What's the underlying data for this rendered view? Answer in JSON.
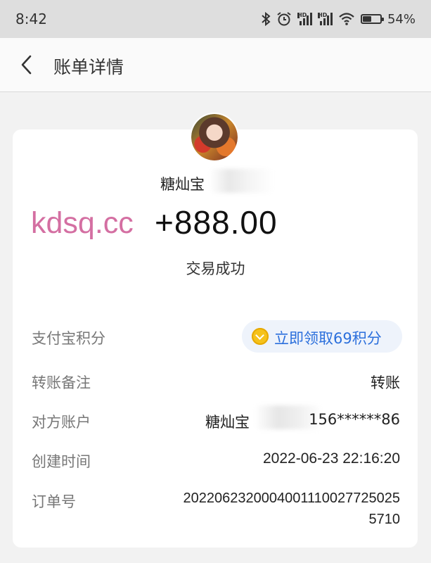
{
  "status_bar": {
    "time": "8:42",
    "battery": "54%",
    "battery_level": 0.54,
    "icons": [
      "bluetooth-icon",
      "alarm-icon",
      "hd-signal-icon",
      "hd-signal-icon",
      "wifi-icon",
      "battery-icon"
    ]
  },
  "header": {
    "title": "账单详情",
    "back_icon": "chevron-left-icon"
  },
  "transaction": {
    "payee": "糖灿宝",
    "watermark": "kdsq.cc",
    "amount": "+888.00",
    "status": "交易成功"
  },
  "details": {
    "points_label": "支付宝积分",
    "points_action": "立即领取69积分",
    "remark_label": "转账备注",
    "remark_value": "转账",
    "account_label": "对方账户",
    "account_prefix": "糖灿宝",
    "account_suffix": "156******86",
    "created_label": "创建时间",
    "created_value": "2022-06-23 22:16:20",
    "order_label": "订单号",
    "order_line1": "2022062320004001110027725025",
    "order_line2": "5710"
  },
  "colors": {
    "accent_blue": "#2b6fdc",
    "watermark_pink": "#d46fa2",
    "coin_gold": "#f5c21b"
  }
}
